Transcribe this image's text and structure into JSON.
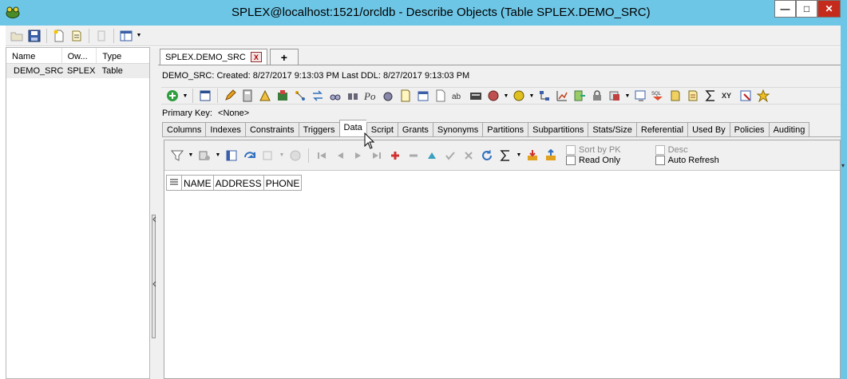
{
  "window": {
    "title": "SPLEX@localhost:1521/orcldb - Describe Objects (Table SPLEX.DEMO_SRC)",
    "controls": {
      "minimize": "—",
      "maximize": "□",
      "close": "✕"
    },
    "title_bar_color": "#6ec6e6"
  },
  "main_toolbar": {
    "icons": [
      "open-folder-icon",
      "save-icon",
      "new-document-icon",
      "copy-icon",
      "paste-icon",
      "grid-options-icon"
    ]
  },
  "object_list": {
    "columns": [
      "Name",
      "Ow...",
      "Type"
    ],
    "rows": [
      {
        "name": "DEMO_SRC",
        "owner": "SPLEX",
        "type": "Table"
      }
    ]
  },
  "document": {
    "tab_label": "SPLEX.DEMO_SRC",
    "tab_close": "X",
    "add_tab": "+",
    "info": "DEMO_SRC:  Created: 8/27/2017 9:13:03 PM   Last DDL: 8/27/2017 9:13:03 PM",
    "primary_key_label": "Primary Key:",
    "primary_key_value": "<None>"
  },
  "subtabs": [
    "Columns",
    "Indexes",
    "Constraints",
    "Triggers",
    "Data",
    "Script",
    "Grants",
    "Synonyms",
    "Partitions",
    "Subpartitions",
    "Stats/Size",
    "Referential",
    "Used By",
    "Policies",
    "Auditing"
  ],
  "active_subtab": "Data",
  "data_toolbar": {
    "sort_by_pk": "Sort by PK",
    "read_only": "Read Only",
    "desc": "Desc",
    "auto_refresh": "Auto Refresh"
  },
  "grid": {
    "columns": [
      "NAME",
      "ADDRESS",
      "PHONE"
    ]
  }
}
